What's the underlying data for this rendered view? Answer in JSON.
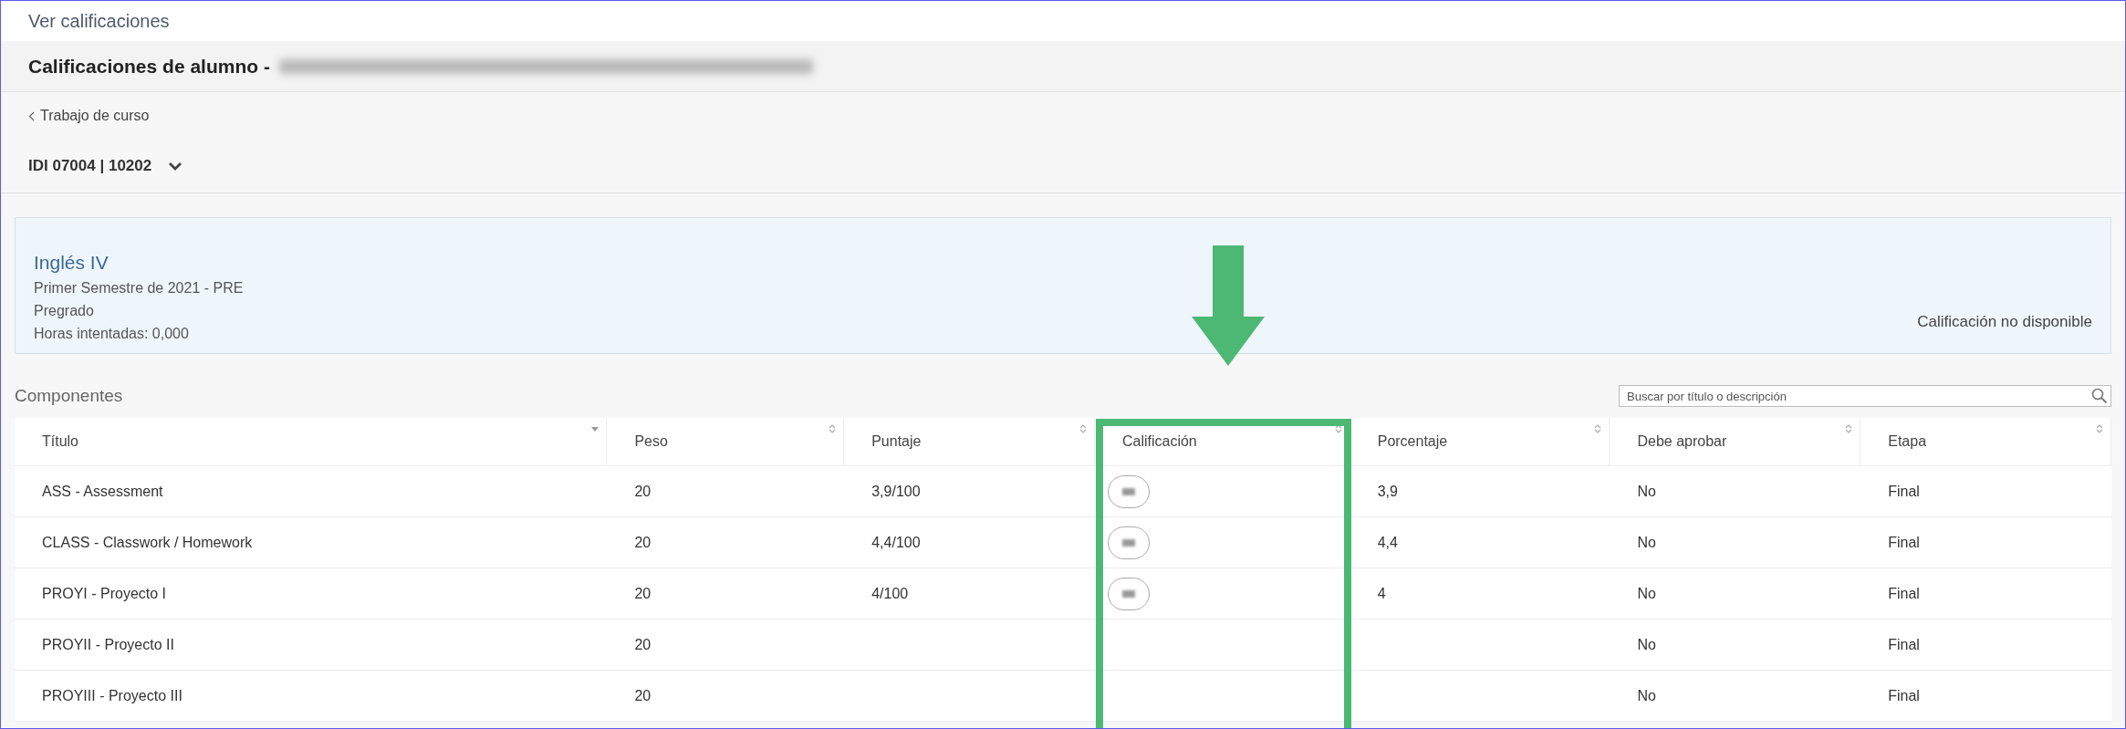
{
  "top_bar": {
    "title": "Ver calificaciones"
  },
  "page_title": {
    "text": "Calificaciones de alumno -",
    "name_redacted": true
  },
  "back_link": {
    "label": "Trabajo de curso"
  },
  "course_selector": {
    "label": "IDI 07004 | 10202"
  },
  "course_card": {
    "title": "Inglés IV",
    "lines": [
      "Primer Semestre de 2021 - PRE",
      "Pregrado",
      "Horas intentadas: 0,000"
    ],
    "status": "Calificación no disponible"
  },
  "components": {
    "title": "Componentes",
    "search": {
      "placeholder": "Buscar por título o descripción"
    },
    "columns": [
      {
        "label": "Título",
        "sorted": true,
        "highlighted": false
      },
      {
        "label": "Peso",
        "sorted": false,
        "highlighted": false
      },
      {
        "label": "Puntaje",
        "sorted": false,
        "highlighted": false
      },
      {
        "label": "Calificación",
        "sorted": false,
        "highlighted": true
      },
      {
        "label": "Porcentaje",
        "sorted": false,
        "highlighted": false
      },
      {
        "label": "Debe aprobar",
        "sorted": false,
        "highlighted": false
      },
      {
        "label": "Etapa",
        "sorted": false,
        "highlighted": false
      }
    ],
    "rows": [
      {
        "title": "ASS - Assessment",
        "weight": "20",
        "score": "3,9/100",
        "grade_badge": true,
        "percent": "3,9",
        "must_pass": "No",
        "stage": "Final"
      },
      {
        "title": "CLASS - Classwork / Homework",
        "weight": "20",
        "score": "4,4/100",
        "grade_badge": true,
        "percent": "4,4",
        "must_pass": "No",
        "stage": "Final"
      },
      {
        "title": "PROYI - Proyecto I",
        "weight": "20",
        "score": "4/100",
        "grade_badge": true,
        "percent": "4",
        "must_pass": "No",
        "stage": "Final"
      },
      {
        "title": "PROYII - Proyecto II",
        "weight": "20",
        "grade_badge": false,
        "must_pass": "No",
        "stage": "Final"
      },
      {
        "title": "PROYIII - Proyecto III",
        "weight": "20",
        "grade_badge": false,
        "must_pass": "No",
        "stage": "Final"
      }
    ]
  }
}
